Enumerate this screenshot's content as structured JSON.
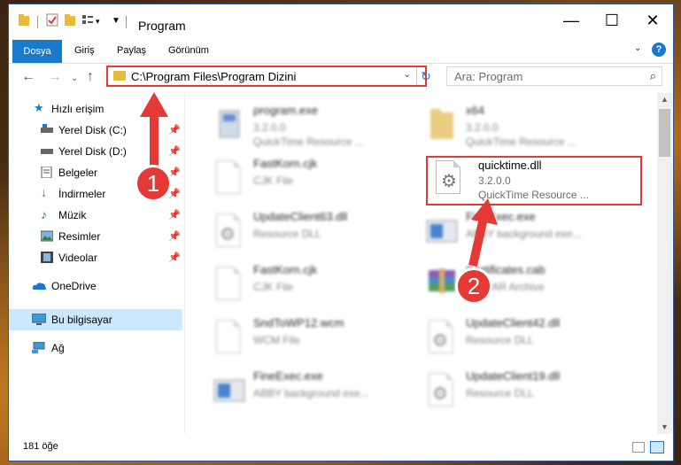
{
  "window": {
    "title": "Program",
    "minimize": "—",
    "maximize": "☐",
    "close": "✕"
  },
  "ribbon": {
    "tabs": [
      "Dosya",
      "Giriş",
      "Paylaş",
      "Görünüm"
    ],
    "help": "?"
  },
  "address": {
    "path": "C:\\Program Files\\Program Dizini",
    "refresh": "↻"
  },
  "search": {
    "placeholder": "Ara: Program"
  },
  "sidebar": {
    "items": [
      {
        "label": "Hızlı erişim",
        "icon": "star-icon"
      },
      {
        "label": "Yerel Disk (C:)",
        "icon": "drive-icon"
      },
      {
        "label": "Yerel Disk (D:)",
        "icon": "drive-icon"
      },
      {
        "label": "Belgeler",
        "icon": "documents-icon"
      },
      {
        "label": "İndirmeler",
        "icon": "download-icon"
      },
      {
        "label": "Müzik",
        "icon": "music-icon"
      },
      {
        "label": "Resimler",
        "icon": "pictures-icon"
      },
      {
        "label": "Videolar",
        "icon": "video-icon"
      },
      {
        "label": "OneDrive",
        "icon": "cloud-icon"
      },
      {
        "label": "Bu bilgisayar",
        "icon": "computer-icon"
      },
      {
        "label": "Ağ",
        "icon": "network-icon"
      }
    ]
  },
  "files": [
    {
      "name": "program.exe",
      "line1": "3.2.0.0",
      "line2": "QuickTime Resource ...",
      "icon": "exe-icon"
    },
    {
      "name": "x64",
      "line1": "3.2.0.0",
      "line2": "QuickTime Resource ...",
      "icon": "folder-icon"
    },
    {
      "name": "FastKorn.cjk",
      "line1": "CJK File",
      "line2": "",
      "icon": "file-icon"
    },
    {
      "name": "quicktime.dll",
      "line1": "3.2.0.0",
      "line2": "QuickTime Resource ...",
      "icon": "dll-icon"
    },
    {
      "name": "UpdateClient63.dll",
      "line1": "Resource DLL",
      "line2": "",
      "icon": "dll-icon"
    },
    {
      "name": "FineExec.exe",
      "line1": "ABBY background exe...",
      "line2": "",
      "icon": "exe-icon"
    },
    {
      "name": "FastKorn.cjk",
      "line1": "CJK File",
      "line2": "",
      "icon": "file-icon"
    },
    {
      "name": "Certificates.cab",
      "line1": "WinRAR Archive",
      "line2": "",
      "icon": "archive-icon"
    },
    {
      "name": "SndToWP12.wcm",
      "line1": "WCM File",
      "line2": "",
      "icon": "file-icon"
    },
    {
      "name": "UpdateClient42.dll",
      "line1": "Resource DLL",
      "line2": "",
      "icon": "dll-icon"
    },
    {
      "name": "FineExec.exe",
      "line1": "ABBY background exe...",
      "line2": "",
      "icon": "exe-icon"
    },
    {
      "name": "UpdateClient19.dll",
      "line1": "Resource DLL",
      "line2": "",
      "icon": "dll-icon"
    }
  ],
  "status": {
    "count": "181 öğe"
  },
  "annotations": {
    "step1": "1",
    "step2": "2"
  },
  "colors": {
    "accent": "#1979ca",
    "annotation": "#e53935",
    "selected": "#cce8ff"
  }
}
